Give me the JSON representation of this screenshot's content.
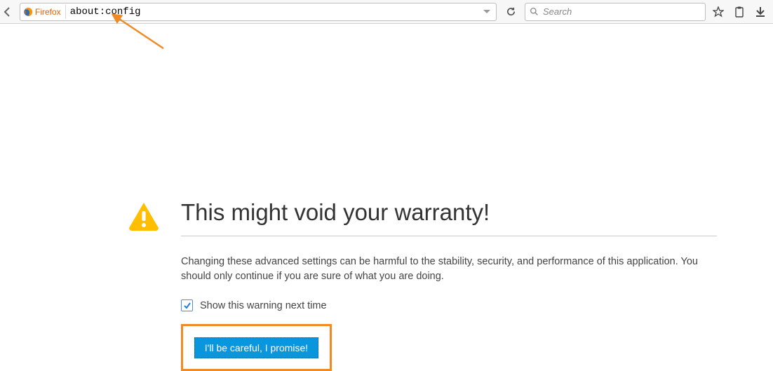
{
  "toolbar": {
    "brand_label": "Firefox",
    "url_value": "about:config",
    "search_placeholder": "Search"
  },
  "page": {
    "title": "This might void your warranty!",
    "description": "Changing these advanced settings can be harmful to the stability, security, and performance of this application. You should only continue if you are sure of what you are doing.",
    "checkbox_label": "Show this warning next time",
    "checkbox_checked": true,
    "confirm_label": "I'll be careful, I promise!"
  },
  "colors": {
    "accent_orange": "#f08a24",
    "firefox_orange": "#e66000",
    "button_blue": "#0996dd",
    "warn_yellow": "#ffbf00"
  }
}
